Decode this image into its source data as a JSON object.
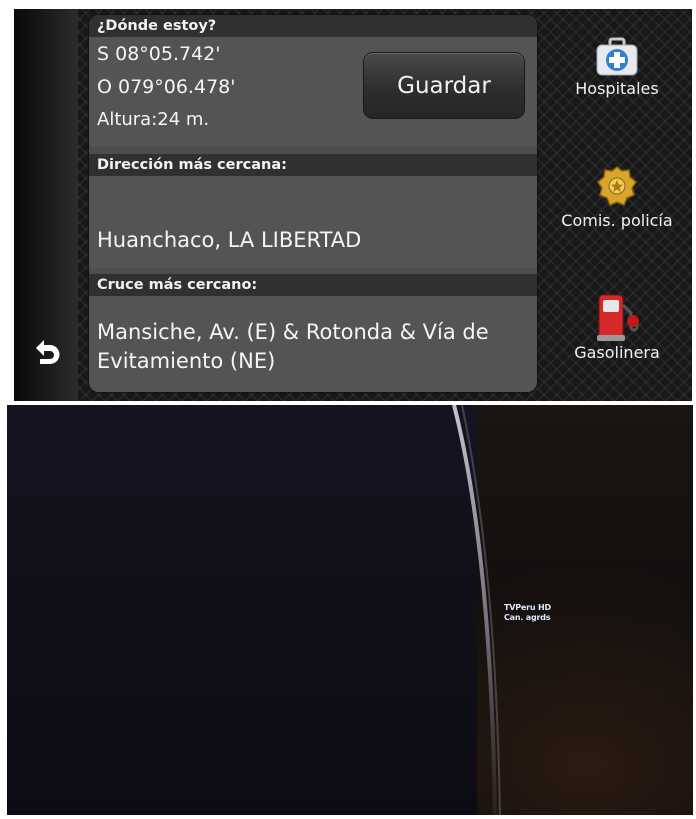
{
  "gps": {
    "location_header": "¿Dónde estoy?",
    "latitude": "S 08°05.742'",
    "longitude": "O 079°06.478'",
    "altitude": "Altura:24 m.",
    "save_label": "Guardar",
    "nearest_address_header": "Dirección más cercana:",
    "nearest_address": "Huanchaco, LA LIBERTAD",
    "nearest_intersection_header": "Cruce más cercano:",
    "nearest_intersection": "Mansiche, Av. (E) & Rotonda & Vía de Evitamiento (NE)",
    "back_icon": "back-arrow-icon",
    "pois": [
      {
        "label": "Hospitales",
        "icon": "hospital-kit-icon"
      },
      {
        "label": "Comis. policía",
        "icon": "police-badge-icon"
      },
      {
        "label": "Gasolinera",
        "icon": "fuel-pump-icon"
      }
    ]
  },
  "tv_photo": {
    "channel_name": "TVPeru HD",
    "channel_subtitle": "Can. agrds"
  },
  "colors": {
    "panel": "#4d4d4d",
    "header": "#303030",
    "text": "#f5f5f5",
    "hospital_blue": "#2f7fd6",
    "police_gold": "#d9a52a",
    "fuel_red": "#d62a2a"
  }
}
